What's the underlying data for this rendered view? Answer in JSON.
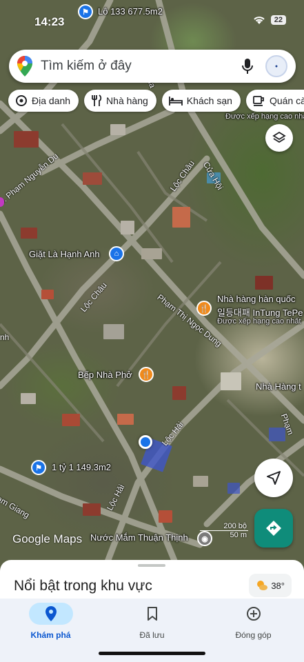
{
  "status_bar": {
    "time": "14:23",
    "battery": "22"
  },
  "search": {
    "placeholder": "Tìm kiếm ở đây"
  },
  "chips": [
    {
      "label": "Địa danh",
      "icon": "landmark-icon"
    },
    {
      "label": "Nhà hàng",
      "icon": "restaurant-icon"
    },
    {
      "label": "Khách sạn",
      "icon": "hotel-icon"
    },
    {
      "label": "Quán cà",
      "icon": "cafe-icon"
    }
  ],
  "map": {
    "places": {
      "lot_top": "Lô 133 677.5m2",
      "lot_bottom": "1 tỷ 1 149.3m2",
      "laundry": "Giặt Là Hạnh Anh",
      "kitchen": "Bếp Nhà Phở",
      "korean_restaurant": "Nhà hàng hàn quốc",
      "korean_restaurant_sub": "일등대패 InTung TePe",
      "highly_rated": "Được xếp hạng cao nhất",
      "highly_rated_top": "Được xếp hạng cao nha",
      "nha_hang_right": "Nhà Hàng t",
      "fish_sauce": "Nước Mắm Thuận Thịnh"
    },
    "roads": {
      "pham_nguyen_du": "Đ. Phạm Nguyễn Du",
      "loc_chau_top": "Lộc Châu",
      "loc_chau_left": "Lộc Châu",
      "cua_hoi": "Cửa Hội",
      "pham_thi_ngoc_dung": "Phạm Thị Ngọc Dung",
      "loc_hai_mid": "Lộc Hải",
      "loc_hai_bottom": "Lộc Hải",
      "giang": "am Giang",
      "pham_right": "Phạm",
      "ua": "ua",
      "tinh": "nh"
    },
    "logo": "Google Maps",
    "scale_ft": "200 bộ",
    "scale_m": "50 m"
  },
  "sheet": {
    "title": "Nổi bật trong khu vực",
    "temperature": "38°"
  },
  "nav": [
    {
      "label": "Khám phá",
      "active": true
    },
    {
      "label": "Đã lưu",
      "active": false
    },
    {
      "label": "Đóng góp",
      "active": false
    }
  ]
}
